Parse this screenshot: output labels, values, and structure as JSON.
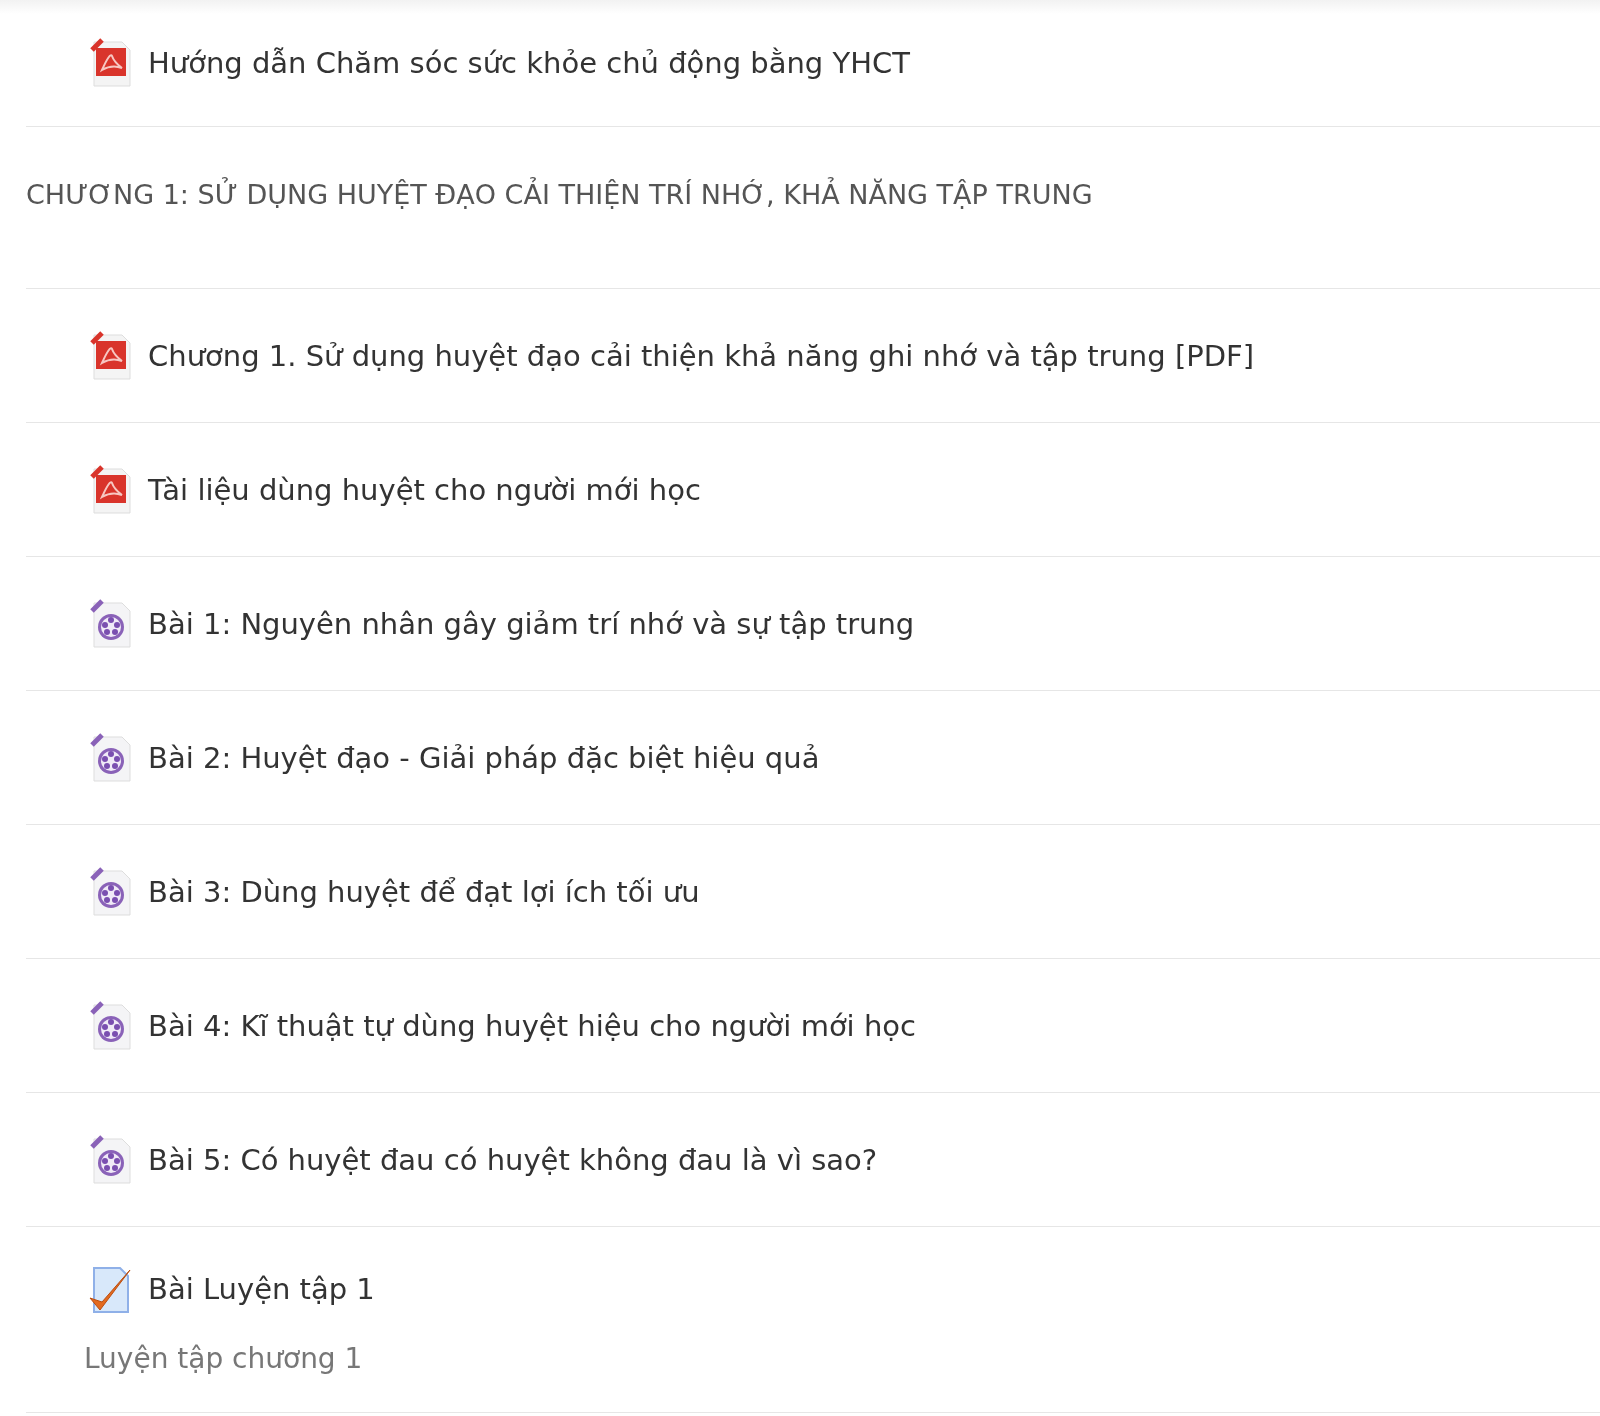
{
  "top_items": [
    {
      "kind": "pdf",
      "title": "Hướng dẫn Chăm sóc sức khỏe chủ động bằng YHCT"
    }
  ],
  "section": {
    "heading": "CHƯƠNG 1: SỬ DỤNG HUYỆT ĐẠO CẢI THIỆN TRÍ NHỚ, KHẢ NĂNG TẬP TRUNG",
    "items": [
      {
        "kind": "pdf",
        "title": "Chương 1. Sử dụng huyệt đạo cải thiện khả năng ghi nhớ và tập trung [PDF]"
      },
      {
        "kind": "pdf",
        "title": "Tài liệu dùng huyệt cho người mới học"
      },
      {
        "kind": "video",
        "title": "Bài 1: Nguyên nhân gây giảm trí nhớ và sự tập trung"
      },
      {
        "kind": "video",
        "title": "Bài 2: Huyệt đạo - Giải pháp đặc biệt hiệu quả"
      },
      {
        "kind": "video",
        "title": "Bài 3: Dùng huyệt để đạt lợi ích tối ưu"
      },
      {
        "kind": "video",
        "title": "Bài 4: Kĩ thuật tự dùng huyệt hiệu cho người mới học"
      },
      {
        "kind": "video",
        "title": "Bài 5: Có huyệt đau có huyệt không đau là vì sao?"
      },
      {
        "kind": "quiz",
        "title": "Bài Luyện tập 1",
        "description": "Luyện tập chương 1"
      }
    ]
  }
}
